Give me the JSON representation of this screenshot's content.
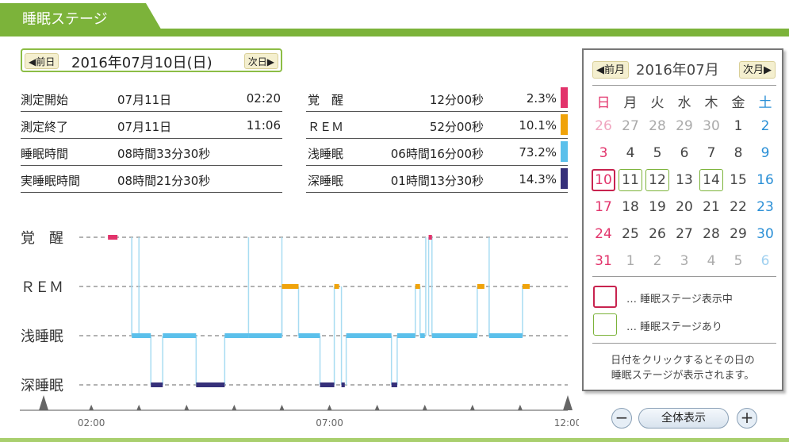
{
  "header": {
    "title": "睡眠ステージ"
  },
  "date_nav": {
    "prev_label": "◀前日",
    "date": "2016年07月10日(日)",
    "next_label": "次日▶"
  },
  "summary_left": [
    {
      "label": "測定開始",
      "date": "07月11日",
      "time": "02:20"
    },
    {
      "label": "測定終了",
      "date": "07月11日",
      "time": "11:06"
    },
    {
      "label": "睡眠時間",
      "value": "08時間33分30秒"
    },
    {
      "label": "実睡眠時間",
      "value": "08時間21分30秒"
    }
  ],
  "summary_right": [
    {
      "label": "覚　醒",
      "duration": "12分00秒",
      "percent": "2.3%",
      "color": "#e2336b"
    },
    {
      "label": "ＲＥＭ",
      "duration": "52分00秒",
      "percent": "10.1%",
      "color": "#f0a30a"
    },
    {
      "label": "浅睡眠",
      "duration": "06時間16分00秒",
      "percent": "73.2%",
      "color": "#5bc0eb"
    },
    {
      "label": "深睡眠",
      "duration": "01時間13分30秒",
      "percent": "14.3%",
      "color": "#36307a"
    }
  ],
  "chart_data": {
    "type": "line",
    "title": "",
    "stages": [
      "覚　醒",
      "ＲＥＭ",
      "浅睡眠",
      "深睡眠"
    ],
    "x_ticks": [
      "02:00",
      "07:00",
      "12:00"
    ],
    "x_range_hours": [
      0.5,
      12.0
    ],
    "segments": [
      {
        "stage": 0,
        "start": 2.35,
        "end": 2.55
      },
      {
        "stage": 2,
        "start": 2.85,
        "end": 3.25
      },
      {
        "stage": 3,
        "start": 3.25,
        "end": 3.5
      },
      {
        "stage": 2,
        "start": 3.5,
        "end": 4.2
      },
      {
        "stage": 3,
        "start": 4.2,
        "end": 4.8
      },
      {
        "stage": 2,
        "start": 4.8,
        "end": 5.3
      },
      {
        "stage": 2,
        "start": 5.3,
        "end": 6.0
      },
      {
        "stage": 1,
        "start": 6.0,
        "end": 6.35
      },
      {
        "stage": 2,
        "start": 6.35,
        "end": 6.8
      },
      {
        "stage": 3,
        "start": 6.8,
        "end": 7.1
      },
      {
        "stage": 1,
        "start": 7.1,
        "end": 7.2
      },
      {
        "stage": 3,
        "start": 7.25,
        "end": 7.32
      },
      {
        "stage": 2,
        "start": 7.35,
        "end": 8.3
      },
      {
        "stage": 3,
        "start": 8.3,
        "end": 8.42
      },
      {
        "stage": 2,
        "start": 8.42,
        "end": 8.8
      },
      {
        "stage": 1,
        "start": 8.8,
        "end": 8.9
      },
      {
        "stage": 2,
        "start": 8.9,
        "end": 9.0
      },
      {
        "stage": 0,
        "start": 9.08,
        "end": 9.15
      },
      {
        "stage": 2,
        "start": 9.15,
        "end": 10.1
      },
      {
        "stage": 1,
        "start": 10.1,
        "end": 10.25
      },
      {
        "stage": 2,
        "start": 10.35,
        "end": 11.05
      },
      {
        "stage": 1,
        "start": 11.05,
        "end": 11.2
      }
    ],
    "spikes": [
      {
        "from": 2,
        "to": 0,
        "at": 2.85
      },
      {
        "from": 2,
        "to": 0,
        "at": 3.0
      },
      {
        "from": 2,
        "to": 0,
        "at": 5.3
      },
      {
        "from": 2,
        "to": 0,
        "at": 6.0
      },
      {
        "from": 2,
        "to": 0,
        "at": 9.02
      },
      {
        "from": 2,
        "to": 0,
        "at": 10.35
      }
    ]
  },
  "calendar": {
    "prev_label": "◀前月",
    "title": "2016年07月",
    "next_label": "次月▶",
    "weekdays": [
      "日",
      "月",
      "火",
      "水",
      "木",
      "金",
      "土"
    ],
    "weeks": [
      [
        "26",
        "27",
        "28",
        "29",
        "30",
        "1",
        "2"
      ],
      [
        "3",
        "4",
        "5",
        "6",
        "7",
        "8",
        "9"
      ],
      [
        "10",
        "11",
        "12",
        "13",
        "14",
        "15",
        "16"
      ],
      [
        "17",
        "18",
        "19",
        "20",
        "21",
        "22",
        "23"
      ],
      [
        "24",
        "25",
        "26",
        "27",
        "28",
        "29",
        "30"
      ],
      [
        "31",
        "1",
        "2",
        "3",
        "4",
        "5",
        "6"
      ]
    ],
    "selected": "10",
    "with_data": [
      "11",
      "12",
      "14"
    ],
    "legend": [
      {
        "text": "… 睡眠ステージ表示中"
      },
      {
        "text": "… 睡眠ステージあり"
      }
    ],
    "note_line1": "日付をクリックするとその日の",
    "note_line2": "睡眠ステージが表示されます。"
  },
  "zoom": {
    "minus": "−",
    "full": "全体表示",
    "plus": "+"
  },
  "colors": {
    "green": "#7cb33a",
    "selected": "#c8234f",
    "sunday": "#e2336b",
    "saturday": "#2a8fd6",
    "muted": "#aaaaaa"
  }
}
